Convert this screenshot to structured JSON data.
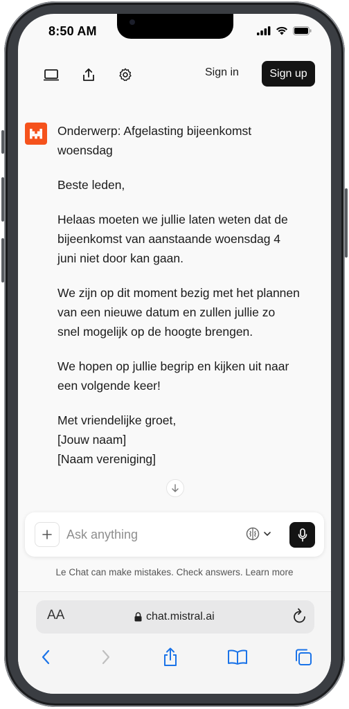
{
  "status_bar": {
    "time": "8:50 AM"
  },
  "header": {
    "sign_in": "Sign in",
    "sign_up": "Sign up",
    "icons": [
      "sidebar-icon",
      "share-icon",
      "settings-gear-icon"
    ]
  },
  "message": {
    "subject": "Onderwerp: Afgelasting bijeenkomst woensdag",
    "greeting": "Beste leden,",
    "paragraphs": [
      "Helaas moeten we jullie laten weten dat de bijeenkomst van aanstaande woensdag 4 juni niet door kan gaan.",
      "We zijn op dit moment bezig met het plannen van een nieuwe datum en zullen jullie zo snel mogelijk op de hoogte brengen.",
      "We hopen op jullie begrip en kijken uit naar een volgende keer!"
    ],
    "closing": "Met vriendelijke groet,",
    "name": "[Jouw naam]",
    "org": "[Naam vereniging]"
  },
  "composer": {
    "placeholder": "Ask anything"
  },
  "disclaimer": "Le Chat can make mistakes. Check answers. Learn more",
  "browser": {
    "aa_label": "AA",
    "url": "chat.mistral.ai"
  },
  "colors": {
    "brand": "#f5521c",
    "dark_button": "#141414",
    "ios_blue": "#1a73e8"
  }
}
